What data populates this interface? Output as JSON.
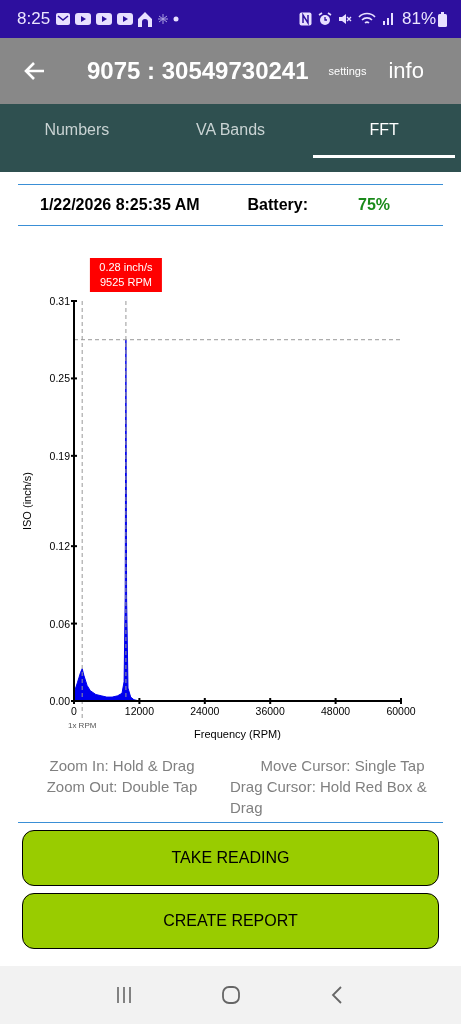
{
  "status_bar": {
    "time": "8:25",
    "battery": "81%"
  },
  "app_bar": {
    "title": "9075 : 30549730241",
    "settings": "settings",
    "info": "info"
  },
  "tabs": [
    {
      "label": "Numbers",
      "selected": false
    },
    {
      "label": "VA Bands",
      "selected": false
    },
    {
      "label": "FFT",
      "selected": true
    }
  ],
  "reading": {
    "timestamp": "1/22/2026 8:25:35 AM",
    "battery_label": "Battery:",
    "battery_value": "75%"
  },
  "chart": {
    "chart_data": {
      "type": "area",
      "xlabel": "Frequency (RPM)",
      "ylabel": "ISO (inch/s)",
      "x": [
        0,
        300,
        600,
        900,
        1200,
        1500,
        1800,
        2400,
        3000,
        4000,
        5000,
        6000,
        7000,
        8000,
        8800,
        9200,
        9400,
        9525,
        9650,
        9900,
        10400,
        11000,
        12000,
        20000,
        30000,
        40000,
        50000,
        60000
      ],
      "series": [
        {
          "color": "#0000ee",
          "values": [
            0.005,
            0.01,
            0.014,
            0.018,
            0.022,
            0.025,
            0.02,
            0.012,
            0.008,
            0.005,
            0.004,
            0.003,
            0.003,
            0.004,
            0.006,
            0.015,
            0.08,
            0.28,
            0.08,
            0.01,
            0.003,
            0.001,
            0,
            0,
            0,
            0,
            0,
            0
          ]
        }
      ],
      "xlim": [
        0,
        60000
      ],
      "ylim": [
        0,
        0.31
      ],
      "xticks": [
        0,
        12000,
        24000,
        36000,
        48000,
        60000
      ],
      "yticks": [
        {
          "value": 0,
          "label": "0.00"
        },
        {
          "value": 0.06,
          "label": "0.06"
        },
        {
          "value": 0.12,
          "label": "0.12"
        },
        {
          "value": 0.19,
          "label": "0.19"
        },
        {
          "value": 0.25,
          "label": "0.25"
        },
        {
          "value": 0.31,
          "label": "0.31"
        }
      ],
      "ref_lines": [
        {
          "axis": "x",
          "value": 1500,
          "label": "1x RPM"
        },
        {
          "axis": "x",
          "value": 9525
        },
        {
          "axis": "y",
          "value": 0.28
        }
      ],
      "annotations": [
        "0.28 inch/s",
        "9525 RPM"
      ]
    }
  },
  "hints": [
    "Zoom In: Hold & Drag",
    "Move Cursor: Single Tap",
    "Zoom Out: Double Tap",
    "Drag Cursor: Hold Red Box & Drag"
  ],
  "buttons": [
    "TAKE READING",
    "CREATE REPORT"
  ]
}
